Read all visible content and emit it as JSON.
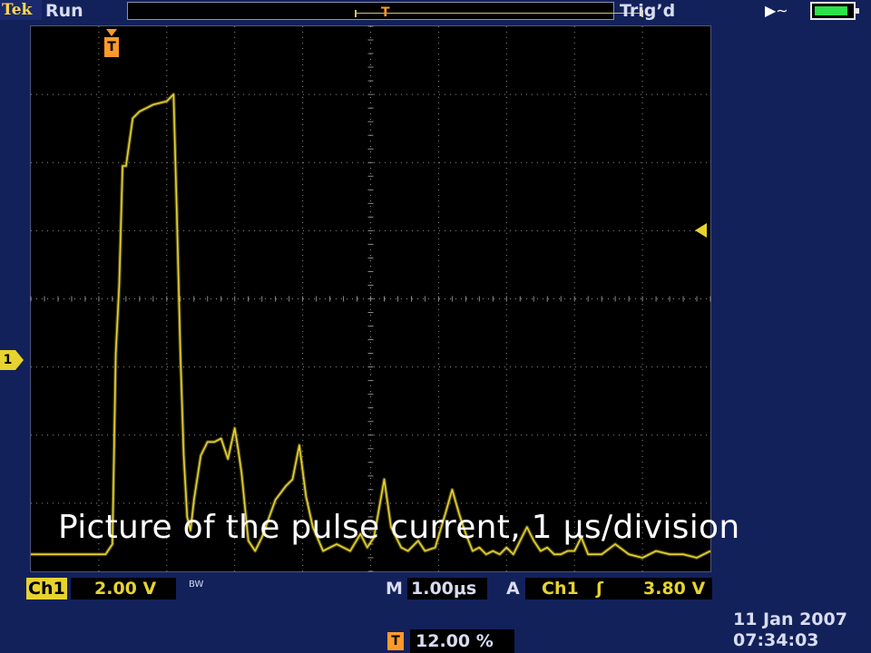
{
  "header": {
    "brand": "Tek",
    "acquisition_state": "Run",
    "trigger_status": "Trig’d",
    "record_trigger_glyph": "T",
    "power_icon": "ac-plug-icon",
    "battery_icon": "battery-full-icon"
  },
  "display": {
    "trigger_marker_glyph": "T",
    "channel_marker_label": "1",
    "caption": "Picture of the pulse current, 1 μs/division",
    "colors": {
      "trace": "#e7d330",
      "grid": "#8c8c8c",
      "background": "#000000",
      "trigger": "#ff9a2a"
    },
    "divisions": {
      "horizontal": 10,
      "vertical": 8
    }
  },
  "status_bar": {
    "channel": "Ch1",
    "volts_per_div": "2.00 V",
    "bandwidth_limit": "BW",
    "timebase_prefix": "M",
    "timebase": "1.00μs",
    "trigger_mode_prefix": "A",
    "trigger_source": "Ch1",
    "trigger_slope_glyph": "ʃ",
    "trigger_level": "3.80 V",
    "trigger_position_glyph": "T",
    "trigger_position": "12.00 %",
    "date": "11 Jan  2007",
    "time": "07:34:03"
  },
  "chart_data": {
    "type": "line",
    "xlabel": "",
    "ylabel": "",
    "x_unit": "μs",
    "y_unit": "V",
    "xlim": [
      -1.2,
      8.8
    ],
    "ylim": [
      -0.4,
      15.6
    ],
    "grid": true,
    "series": [
      {
        "x": [
          -1.2,
          -0.5,
          -0.1,
          0.0,
          0.05,
          0.1,
          0.15,
          0.2,
          0.3,
          0.4,
          0.5,
          0.6,
          0.8,
          0.9,
          0.95,
          1.0,
          1.05,
          1.1,
          1.15,
          1.2,
          1.3,
          1.4,
          1.5,
          1.6,
          1.7,
          1.8,
          1.85,
          1.9,
          2.0,
          2.1,
          2.2,
          2.4,
          2.55,
          2.65,
          2.75,
          2.85,
          2.95,
          3.1,
          3.3,
          3.5,
          3.65,
          3.75,
          3.85,
          4.0,
          4.1,
          4.25,
          4.35,
          4.5,
          4.6,
          4.75,
          4.9,
          5.0,
          5.1,
          5.2,
          5.3,
          5.4,
          5.5,
          5.6,
          5.7,
          5.8,
          5.9,
          6.0,
          6.1,
          6.2,
          6.3,
          6.4,
          6.5,
          6.6,
          6.7,
          6.8,
          6.9,
          7.0,
          7.2,
          7.4,
          7.6,
          7.8,
          8.0,
          8.2,
          8.4,
          8.6,
          8.8
        ],
        "y": [
          0.1,
          0.1,
          0.1,
          0.4,
          6.0,
          8.0,
          11.5,
          11.5,
          12.9,
          13.1,
          13.2,
          13.3,
          13.4,
          13.6,
          10.0,
          6.0,
          3.0,
          1.2,
          0.8,
          1.7,
          3.0,
          3.4,
          3.4,
          3.5,
          2.9,
          3.8,
          3.2,
          2.5,
          0.5,
          0.2,
          0.6,
          1.7,
          2.1,
          2.3,
          3.3,
          1.8,
          0.9,
          0.2,
          0.4,
          0.2,
          0.7,
          0.3,
          0.6,
          2.3,
          0.9,
          0.3,
          0.2,
          0.5,
          0.2,
          0.3,
          1.3,
          2.0,
          1.3,
          0.7,
          0.2,
          0.3,
          0.1,
          0.2,
          0.1,
          0.3,
          0.1,
          0.5,
          0.9,
          0.5,
          0.2,
          0.3,
          0.1,
          0.1,
          0.2,
          0.2,
          0.6,
          0.1,
          0.1,
          0.4,
          0.1,
          0.0,
          0.2,
          0.1,
          0.1,
          0.0,
          0.2
        ]
      }
    ]
  }
}
